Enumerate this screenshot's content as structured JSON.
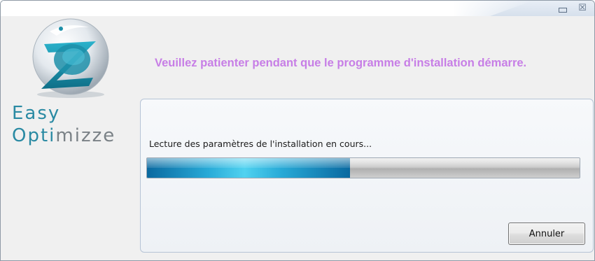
{
  "window": {
    "controls": {
      "minimize_icon": "minimize-icon",
      "close_glyph": "☒"
    }
  },
  "brand": {
    "line1": "Easy",
    "line2_a": "Opti",
    "line2_b": "mizze",
    "logo_icon": "easy-optimizze-logo",
    "colors": {
      "teal": "#2a8aa3",
      "gray": "#7a8186"
    }
  },
  "headline": "Veuillez patienter pendant que le programme d'installation démarre.",
  "panel": {
    "status_text": "Lecture des paramètres de l'installation en cours...",
    "progress_fraction": 0.47,
    "cancel_label": "Annuler"
  },
  "colors": {
    "headline": "#c77ee6",
    "progress": "#28aad7"
  }
}
